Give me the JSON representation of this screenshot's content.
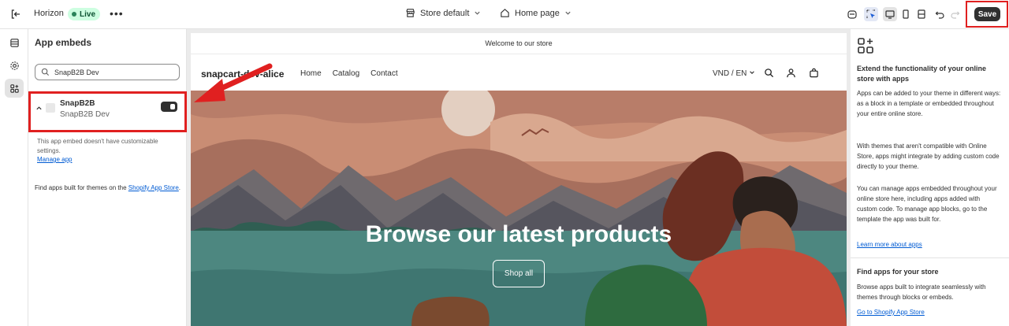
{
  "topbar": {
    "theme_name": "Horizon",
    "live_label": "Live",
    "more_label": "•••",
    "store_label": "Store default",
    "page_label": "Home page",
    "save_label": "Save"
  },
  "panel": {
    "title": "App embeds",
    "search_value": "SnapB2B Dev",
    "search_placeholder": "Search",
    "embed": {
      "name": "SnapB2B",
      "sub": "SnapB2B Dev",
      "enabled": true
    },
    "note": "This app embed doesn't have customizable settings.",
    "manage_link": "Manage app",
    "find_text": "Find apps built for themes on the ",
    "find_link": "Shopify App Store",
    "find_end": "."
  },
  "store": {
    "announcement": "Welcome to our store",
    "logo": "snapcart-dev-alice",
    "nav": [
      "Home",
      "Catalog",
      "Contact"
    ],
    "currency": "VND / EN",
    "hero_title": "Browse our latest products",
    "hero_button": "Shop all"
  },
  "info": {
    "heading1": "Extend the functionality of your online store with apps",
    "para1": "Apps can be added to your theme in different ways: as a block in a template or embedded throughout your entire online store.",
    "para2": "With themes that aren't compatible with Online Store, apps might integrate by adding custom code directly to your theme.",
    "para3": "You can manage apps embedded throughout your online store here, including apps added with custom code. To manage app blocks, go to the template the app was built for.",
    "link1": "Learn more about apps",
    "heading2": "Find apps for your store",
    "para4": "Browse apps built to integrate seamlessly with themes through blocks or embeds.",
    "link2": "Go to Shopify App Store"
  },
  "colors": {
    "accent_red": "#e02020",
    "link_blue": "#005bd3",
    "live_green": "#29845a"
  }
}
